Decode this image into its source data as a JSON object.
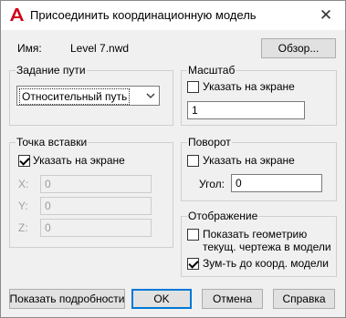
{
  "title": "Присоединить координационную модель",
  "name_label": "Имя:",
  "name_value": "Level 7.nwd",
  "browse_label": "Обзор...",
  "path_group": {
    "title": "Задание пути",
    "path_type": "Относительный путь"
  },
  "scale_group": {
    "title": "Масштаб",
    "specify_label": "Указать на экране",
    "specify_checked": false,
    "value": "1"
  },
  "insert_group": {
    "title": "Точка вставки",
    "specify_label": "Указать на экране",
    "specify_checked": true,
    "x_label": "X:",
    "y_label": "Y:",
    "z_label": "Z:",
    "x_value": "0",
    "y_value": "0",
    "z_value": "0"
  },
  "rotation_group": {
    "title": "Поворот",
    "specify_label": "Указать на экране",
    "specify_checked": false,
    "angle_label": "Угол:",
    "angle_value": "0"
  },
  "display_group": {
    "title": "Отображение",
    "show_geometry_label_line1": "Показать геометрию",
    "show_geometry_label_line2": "текущ. чертежа в модели",
    "show_geometry_checked": false,
    "zoom_label": "Зум-ть до коорд. модели",
    "zoom_checked": true
  },
  "buttons": {
    "details": "Показать подробности",
    "ok": "OK",
    "cancel": "Отмена",
    "help": "Справка"
  },
  "colors": {
    "accent": "#0078d7",
    "app_icon": "#d0021b"
  }
}
